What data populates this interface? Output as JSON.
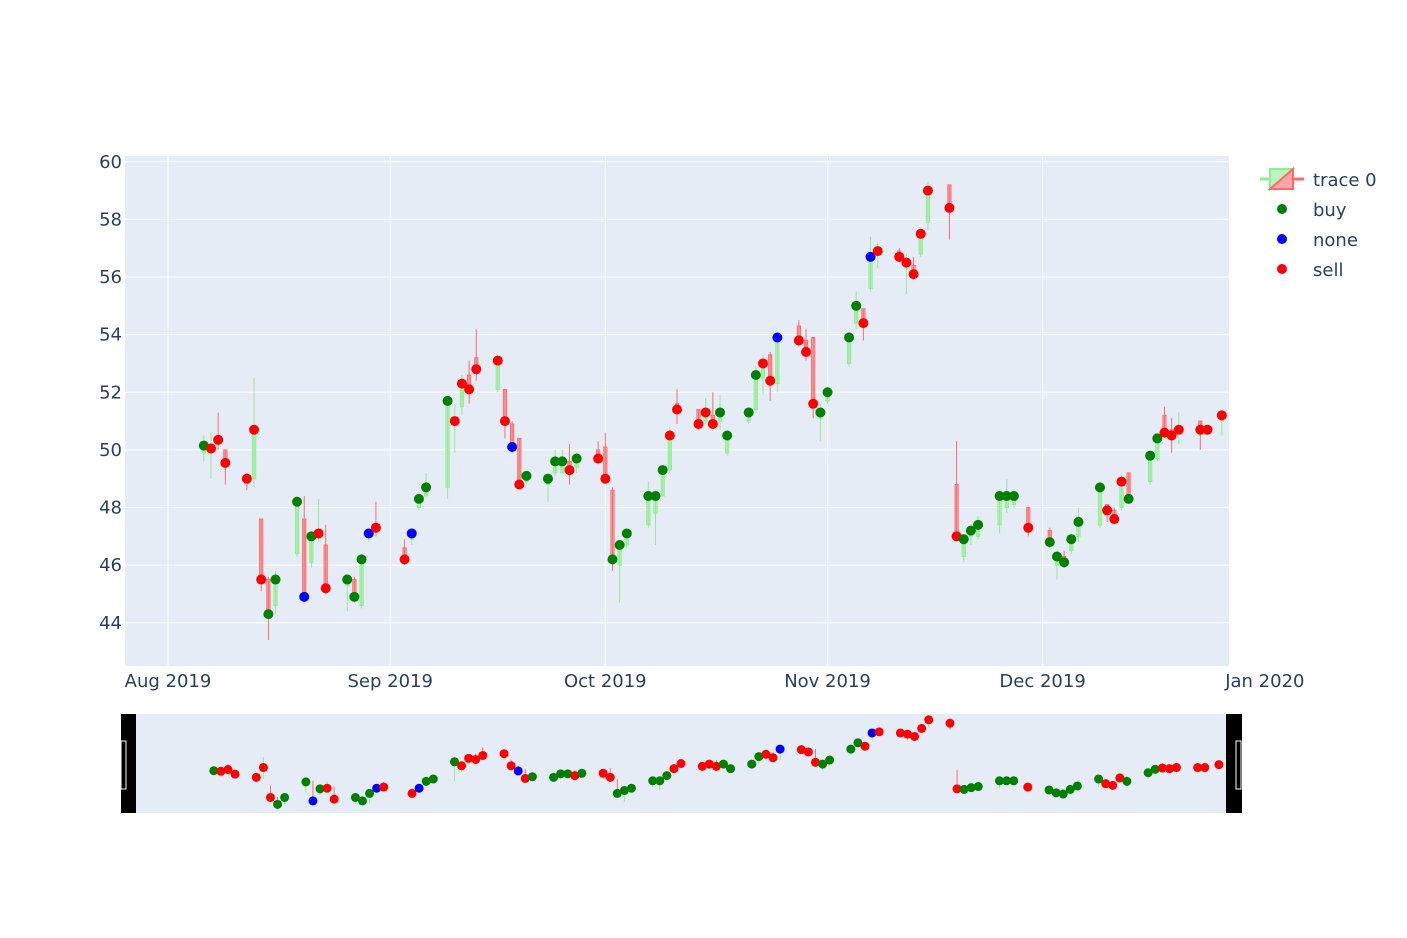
{
  "chart_data": {
    "type": "candlestick",
    "title": "",
    "xlabel": "",
    "ylabel": "",
    "x_range": [
      "2019-07-26",
      "2019-12-27"
    ],
    "ylim": [
      42.5,
      60.2
    ],
    "yticks": [
      44,
      46,
      48,
      50,
      52,
      54,
      56,
      58,
      60
    ],
    "xticks": [
      {
        "date": "2019-08-01",
        "label": "Aug 2019"
      },
      {
        "date": "2019-09-01",
        "label": "Sep 2019"
      },
      {
        "date": "2019-10-01",
        "label": "Oct 2019"
      },
      {
        "date": "2019-11-01",
        "label": "Nov 2019"
      },
      {
        "date": "2019-12-01",
        "label": "Dec 2019"
      },
      {
        "date": "2020-01-01",
        "label": "Jan 2020"
      }
    ],
    "grid": true,
    "legend_position": "top-right",
    "rangeslider": true,
    "colors": {
      "plot_bg": "#e5ecf6",
      "grid": "#ffffff",
      "tick_text": "#2a3f5f",
      "increasing": "#90ee90",
      "decreasing": "#ff6b6b",
      "buy": "#008000",
      "none": "#0000ff",
      "sell": "#ff0000"
    },
    "legend": [
      {
        "name": "trace 0",
        "kind": "candle"
      },
      {
        "name": "buy",
        "kind": "marker",
        "signal": "buy"
      },
      {
        "name": "none",
        "kind": "marker",
        "signal": "none"
      },
      {
        "name": "sell",
        "kind": "marker",
        "signal": "sell"
      }
    ],
    "series": [
      {
        "date": "2019-08-06",
        "open": 49.9,
        "high": 50.5,
        "low": 49.6,
        "close": 50.15,
        "signal": "buy"
      },
      {
        "date": "2019-08-07",
        "open": 50.0,
        "high": 50.6,
        "low": 49.0,
        "close": 50.05,
        "signal": "sell"
      },
      {
        "date": "2019-08-08",
        "open": 50.5,
        "high": 51.3,
        "low": 50.0,
        "close": 50.35,
        "signal": "sell"
      },
      {
        "date": "2019-08-09",
        "open": 50.0,
        "high": 50.0,
        "low": 48.8,
        "close": 49.55,
        "signal": "sell"
      },
      {
        "date": "2019-08-12",
        "open": 49.1,
        "high": 49.2,
        "low": 48.6,
        "close": 49.0,
        "signal": "sell"
      },
      {
        "date": "2019-08-13",
        "open": 49.0,
        "high": 52.5,
        "low": 48.7,
        "close": 50.7,
        "signal": "sell"
      },
      {
        "date": "2019-08-14",
        "open": 47.6,
        "high": 47.6,
        "low": 45.1,
        "close": 45.5,
        "signal": "sell"
      },
      {
        "date": "2019-08-15",
        "open": 45.5,
        "high": 45.6,
        "low": 43.4,
        "close": 44.3,
        "signal": "buy"
      },
      {
        "date": "2019-08-16",
        "open": 44.6,
        "high": 45.8,
        "low": 44.3,
        "close": 45.5,
        "signal": "buy"
      },
      {
        "date": "2019-08-19",
        "open": 46.4,
        "high": 48.4,
        "low": 46.3,
        "close": 48.2,
        "signal": "buy"
      },
      {
        "date": "2019-08-20",
        "open": 47.6,
        "high": 48.4,
        "low": 44.8,
        "close": 44.9,
        "signal": "none"
      },
      {
        "date": "2019-08-21",
        "open": 46.1,
        "high": 47.1,
        "low": 45.9,
        "close": 47.0,
        "signal": "buy"
      },
      {
        "date": "2019-08-22",
        "open": 47.0,
        "high": 48.3,
        "low": 46.8,
        "close": 47.1,
        "signal": "sell"
      },
      {
        "date": "2019-08-23",
        "open": 46.7,
        "high": 47.4,
        "low": 45.0,
        "close": 45.2,
        "signal": "sell"
      },
      {
        "date": "2019-08-26",
        "open": 45.3,
        "high": 45.6,
        "low": 44.4,
        "close": 45.5,
        "signal": "buy"
      },
      {
        "date": "2019-08-27",
        "open": 45.5,
        "high": 45.6,
        "low": 44.7,
        "close": 44.9,
        "signal": "buy"
      },
      {
        "date": "2019-08-28",
        "open": 44.6,
        "high": 46.4,
        "low": 44.5,
        "close": 46.2,
        "signal": "buy"
      },
      {
        "date": "2019-08-29",
        "open": 47.0,
        "high": 47.3,
        "low": 46.8,
        "close": 47.1,
        "signal": "none"
      },
      {
        "date": "2019-08-30",
        "open": 47.4,
        "high": 48.2,
        "low": 47.0,
        "close": 47.3,
        "signal": "sell"
      },
      {
        "date": "2019-09-03",
        "open": 46.6,
        "high": 46.9,
        "low": 46.0,
        "close": 46.2,
        "signal": "sell"
      },
      {
        "date": "2019-09-04",
        "open": 46.9,
        "high": 47.2,
        "low": 46.7,
        "close": 47.1,
        "signal": "none"
      },
      {
        "date": "2019-09-05",
        "open": 48.0,
        "high": 48.5,
        "low": 47.9,
        "close": 48.3,
        "signal": "buy"
      },
      {
        "date": "2019-09-06",
        "open": 48.4,
        "high": 49.2,
        "low": 48.4,
        "close": 48.7,
        "signal": "buy"
      },
      {
        "date": "2019-09-09",
        "open": 48.7,
        "high": 51.8,
        "low": 48.3,
        "close": 51.7,
        "signal": "buy"
      },
      {
        "date": "2019-09-10",
        "open": 51.0,
        "high": 51.6,
        "low": 49.9,
        "close": 51.0,
        "signal": "sell"
      },
      {
        "date": "2019-09-11",
        "open": 51.5,
        "high": 52.6,
        "low": 51.2,
        "close": 52.3,
        "signal": "sell"
      },
      {
        "date": "2019-09-12",
        "open": 52.6,
        "high": 53.1,
        "low": 51.6,
        "close": 52.1,
        "signal": "sell"
      },
      {
        "date": "2019-09-13",
        "open": 53.2,
        "high": 54.2,
        "low": 52.4,
        "close": 52.8,
        "signal": "sell"
      },
      {
        "date": "2019-09-16",
        "open": 52.1,
        "high": 53.3,
        "low": 52.0,
        "close": 53.1,
        "signal": "sell"
      },
      {
        "date": "2019-09-17",
        "open": 52.1,
        "high": 52.1,
        "low": 50.4,
        "close": 51.0,
        "signal": "sell"
      },
      {
        "date": "2019-09-18",
        "open": 50.9,
        "high": 51.0,
        "low": 49.9,
        "close": 50.1,
        "signal": "none"
      },
      {
        "date": "2019-09-19",
        "open": 50.4,
        "high": 50.4,
        "low": 48.8,
        "close": 48.8,
        "signal": "sell"
      },
      {
        "date": "2019-09-20",
        "open": 48.9,
        "high": 49.2,
        "low": 48.8,
        "close": 49.1,
        "signal": "buy"
      },
      {
        "date": "2019-09-23",
        "open": 48.8,
        "high": 49.2,
        "low": 48.2,
        "close": 49.0,
        "signal": "buy"
      },
      {
        "date": "2019-09-24",
        "open": 49.2,
        "high": 50.0,
        "low": 49.1,
        "close": 49.6,
        "signal": "buy"
      },
      {
        "date": "2019-09-25",
        "open": 49.2,
        "high": 50.0,
        "low": 49.2,
        "close": 49.6,
        "signal": "buy"
      },
      {
        "date": "2019-09-26",
        "open": 49.6,
        "high": 50.2,
        "low": 48.8,
        "close": 49.3,
        "signal": "sell"
      },
      {
        "date": "2019-09-27",
        "open": 49.4,
        "high": 49.9,
        "low": 49.2,
        "close": 49.7,
        "signal": "buy"
      },
      {
        "date": "2019-09-30",
        "open": 50.0,
        "high": 50.3,
        "low": 49.5,
        "close": 49.7,
        "signal": "sell"
      },
      {
        "date": "2019-10-01",
        "open": 50.1,
        "high": 50.6,
        "low": 49.0,
        "close": 49.0,
        "signal": "sell"
      },
      {
        "date": "2019-10-02",
        "open": 48.6,
        "high": 48.7,
        "low": 45.8,
        "close": 46.2,
        "signal": "buy"
      },
      {
        "date": "2019-10-03",
        "open": 46.0,
        "high": 46.8,
        "low": 44.7,
        "close": 46.7,
        "signal": "buy"
      },
      {
        "date": "2019-10-04",
        "open": 46.7,
        "high": 47.2,
        "low": 46.6,
        "close": 47.1,
        "signal": "buy"
      },
      {
        "date": "2019-10-07",
        "open": 47.4,
        "high": 48.9,
        "low": 47.3,
        "close": 48.4,
        "signal": "buy"
      },
      {
        "date": "2019-10-08",
        "open": 47.8,
        "high": 48.6,
        "low": 46.7,
        "close": 48.4,
        "signal": "buy"
      },
      {
        "date": "2019-10-09",
        "open": 48.4,
        "high": 49.4,
        "low": 48.4,
        "close": 49.3,
        "signal": "buy"
      },
      {
        "date": "2019-10-10",
        "open": 49.3,
        "high": 50.8,
        "low": 49.2,
        "close": 50.5,
        "signal": "sell"
      },
      {
        "date": "2019-10-11",
        "open": 51.6,
        "high": 52.1,
        "low": 50.9,
        "close": 51.4,
        "signal": "sell"
      },
      {
        "date": "2019-10-14",
        "open": 51.4,
        "high": 51.4,
        "low": 50.7,
        "close": 50.9,
        "signal": "sell"
      },
      {
        "date": "2019-10-15",
        "open": 51.0,
        "high": 51.8,
        "low": 50.9,
        "close": 51.3,
        "signal": "sell"
      },
      {
        "date": "2019-10-16",
        "open": 51.2,
        "high": 52.0,
        "low": 50.8,
        "close": 50.9,
        "signal": "sell"
      },
      {
        "date": "2019-10-17",
        "open": 51.0,
        "high": 51.9,
        "low": 50.7,
        "close": 51.3,
        "signal": "buy"
      },
      {
        "date": "2019-10-18",
        "open": 49.9,
        "high": 50.6,
        "low": 49.8,
        "close": 50.5,
        "signal": "buy"
      },
      {
        "date": "2019-10-21",
        "open": 51.0,
        "high": 51.4,
        "low": 50.9,
        "close": 51.3,
        "signal": "buy"
      },
      {
        "date": "2019-10-22",
        "open": 51.4,
        "high": 52.9,
        "low": 51.3,
        "close": 52.6,
        "signal": "buy"
      },
      {
        "date": "2019-10-23",
        "open": 52.5,
        "high": 53.3,
        "low": 51.9,
        "close": 53.0,
        "signal": "sell"
      },
      {
        "date": "2019-10-24",
        "open": 53.3,
        "high": 53.4,
        "low": 51.7,
        "close": 52.4,
        "signal": "sell"
      },
      {
        "date": "2019-10-25",
        "open": 52.3,
        "high": 54.0,
        "low": 52.0,
        "close": 53.9,
        "signal": "none"
      },
      {
        "date": "2019-10-28",
        "open": 54.3,
        "high": 54.5,
        "low": 53.6,
        "close": 53.8,
        "signal": "sell"
      },
      {
        "date": "2019-10-29",
        "open": 53.8,
        "high": 54.2,
        "low": 53.1,
        "close": 53.4,
        "signal": "sell"
      },
      {
        "date": "2019-10-30",
        "open": 53.9,
        "high": 53.9,
        "low": 51.1,
        "close": 51.6,
        "signal": "sell"
      },
      {
        "date": "2019-10-31",
        "open": 51.1,
        "high": 51.6,
        "low": 50.3,
        "close": 51.3,
        "signal": "buy"
      },
      {
        "date": "2019-11-01",
        "open": 51.7,
        "high": 52.2,
        "low": 51.6,
        "close": 52.0,
        "signal": "buy"
      },
      {
        "date": "2019-11-04",
        "open": 53.0,
        "high": 54.1,
        "low": 52.9,
        "close": 53.9,
        "signal": "buy"
      },
      {
        "date": "2019-11-05",
        "open": 54.4,
        "high": 55.5,
        "low": 54.2,
        "close": 55.0,
        "signal": "buy"
      },
      {
        "date": "2019-11-06",
        "open": 54.9,
        "high": 54.9,
        "low": 53.8,
        "close": 54.4,
        "signal": "sell"
      },
      {
        "date": "2019-11-07",
        "open": 55.6,
        "high": 57.4,
        "low": 55.5,
        "close": 56.7,
        "signal": "none"
      },
      {
        "date": "2019-11-08",
        "open": 56.8,
        "high": 57.2,
        "low": 56.3,
        "close": 56.9,
        "signal": "sell"
      },
      {
        "date": "2019-11-11",
        "open": 56.9,
        "high": 57.0,
        "low": 56.5,
        "close": 56.7,
        "signal": "sell"
      },
      {
        "date": "2019-11-12",
        "open": 56.3,
        "high": 56.8,
        "low": 55.4,
        "close": 56.5,
        "signal": "sell"
      },
      {
        "date": "2019-11-13",
        "open": 56.4,
        "high": 56.7,
        "low": 55.9,
        "close": 56.1,
        "signal": "sell"
      },
      {
        "date": "2019-11-14",
        "open": 56.8,
        "high": 57.6,
        "low": 56.7,
        "close": 57.5,
        "signal": "sell"
      },
      {
        "date": "2019-11-15",
        "open": 57.9,
        "high": 59.3,
        "low": 57.6,
        "close": 59.0,
        "signal": "sell"
      },
      {
        "date": "2019-11-18",
        "open": 59.2,
        "high": 59.2,
        "low": 57.3,
        "close": 58.4,
        "signal": "sell"
      },
      {
        "date": "2019-11-19",
        "open": 48.8,
        "high": 50.3,
        "low": 46.9,
        "close": 47.0,
        "signal": "sell"
      },
      {
        "date": "2019-11-20",
        "open": 46.3,
        "high": 47.1,
        "low": 46.1,
        "close": 46.9,
        "signal": "buy"
      },
      {
        "date": "2019-11-21",
        "open": 47.0,
        "high": 47.4,
        "low": 46.7,
        "close": 47.2,
        "signal": "buy"
      },
      {
        "date": "2019-11-22",
        "open": 47.0,
        "high": 47.7,
        "low": 46.9,
        "close": 47.4,
        "signal": "buy"
      },
      {
        "date": "2019-11-25",
        "open": 47.4,
        "high": 48.6,
        "low": 47.1,
        "close": 48.4,
        "signal": "buy"
      },
      {
        "date": "2019-11-26",
        "open": 48.0,
        "high": 49.0,
        "low": 47.8,
        "close": 48.4,
        "signal": "buy"
      },
      {
        "date": "2019-11-27",
        "open": 48.1,
        "high": 48.6,
        "low": 48.0,
        "close": 48.4,
        "signal": "buy"
      },
      {
        "date": "2019-11-29",
        "open": 48.0,
        "high": 48.0,
        "low": 47.0,
        "close": 47.3,
        "signal": "sell"
      },
      {
        "date": "2019-12-02",
        "open": 47.2,
        "high": 47.3,
        "low": 46.6,
        "close": 46.8,
        "signal": "buy"
      },
      {
        "date": "2019-12-03",
        "open": 46.0,
        "high": 46.4,
        "low": 45.5,
        "close": 46.3,
        "signal": "buy"
      },
      {
        "date": "2019-12-04",
        "open": 46.3,
        "high": 46.5,
        "low": 45.9,
        "close": 46.1,
        "signal": "buy"
      },
      {
        "date": "2019-12-05",
        "open": 46.5,
        "high": 47.0,
        "low": 46.4,
        "close": 46.9,
        "signal": "buy"
      },
      {
        "date": "2019-12-06",
        "open": 47.0,
        "high": 48.0,
        "low": 46.8,
        "close": 47.5,
        "signal": "buy"
      },
      {
        "date": "2019-12-09",
        "open": 47.4,
        "high": 48.8,
        "low": 47.3,
        "close": 48.7,
        "signal": "buy"
      },
      {
        "date": "2019-12-10",
        "open": 48.1,
        "high": 48.1,
        "low": 47.5,
        "close": 47.9,
        "signal": "sell"
      },
      {
        "date": "2019-12-11",
        "open": 47.9,
        "high": 48.0,
        "low": 47.5,
        "close": 47.6,
        "signal": "sell"
      },
      {
        "date": "2019-12-12",
        "open": 48.0,
        "high": 49.1,
        "low": 47.9,
        "close": 48.9,
        "signal": "sell"
      },
      {
        "date": "2019-12-13",
        "open": 49.2,
        "high": 49.2,
        "low": 48.3,
        "close": 48.3,
        "signal": "buy"
      },
      {
        "date": "2019-12-16",
        "open": 48.9,
        "high": 49.9,
        "low": 48.8,
        "close": 49.8,
        "signal": "buy"
      },
      {
        "date": "2019-12-17",
        "open": 49.7,
        "high": 50.6,
        "low": 49.6,
        "close": 50.4,
        "signal": "buy"
      },
      {
        "date": "2019-12-18",
        "open": 51.2,
        "high": 51.5,
        "low": 50.4,
        "close": 50.6,
        "signal": "sell"
      },
      {
        "date": "2019-12-19",
        "open": 50.7,
        "high": 51.1,
        "low": 49.9,
        "close": 50.5,
        "signal": "sell"
      },
      {
        "date": "2019-12-20",
        "open": 50.6,
        "high": 51.3,
        "low": 50.2,
        "close": 50.7,
        "signal": "sell"
      },
      {
        "date": "2019-12-23",
        "open": 51.0,
        "high": 51.0,
        "low": 50.0,
        "close": 50.7,
        "signal": "sell"
      },
      {
        "date": "2019-12-24",
        "open": 50.8,
        "high": 50.8,
        "low": 50.7,
        "close": 50.7,
        "signal": "sell"
      },
      {
        "date": "2019-12-26",
        "open": 51.0,
        "high": 51.3,
        "low": 50.5,
        "close": 51.2,
        "signal": "sell"
      }
    ]
  }
}
